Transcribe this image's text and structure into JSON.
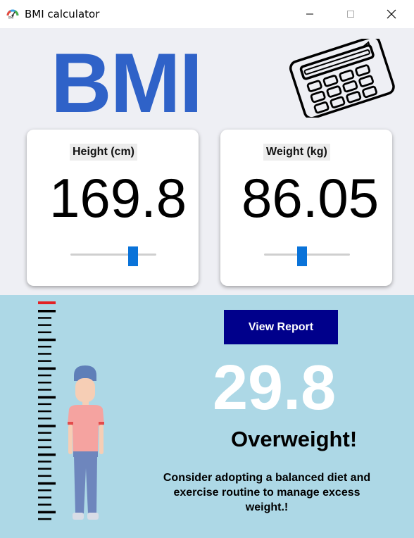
{
  "window": {
    "title": "BMI calculator",
    "icon": "bmi-gauge-icon",
    "controls": [
      "minimize-icon",
      "maximize-icon",
      "close-icon"
    ]
  },
  "logo": {
    "text": "BMI",
    "icon": "calculator-icon",
    "color": "#2f62c8"
  },
  "height_card": {
    "label": "Height (cm)",
    "value": "169.8",
    "slider_fraction": 0.73
  },
  "weight_card": {
    "label": "Weight (kg)",
    "value": "86.05",
    "slider_fraction": 0.44
  },
  "result": {
    "button_label": "View Report",
    "bmi": "29.8",
    "status": "Overweight!",
    "advice": "Consider adopting a balanced diet and exercise routine to manage excess weight.!"
  },
  "colors": {
    "top_background": "#eeeff4",
    "bottom_background": "#add8e6",
    "accent_blue": "#0a73d9",
    "button_navy": "#00008b",
    "ruler_marker": "#e32124"
  }
}
